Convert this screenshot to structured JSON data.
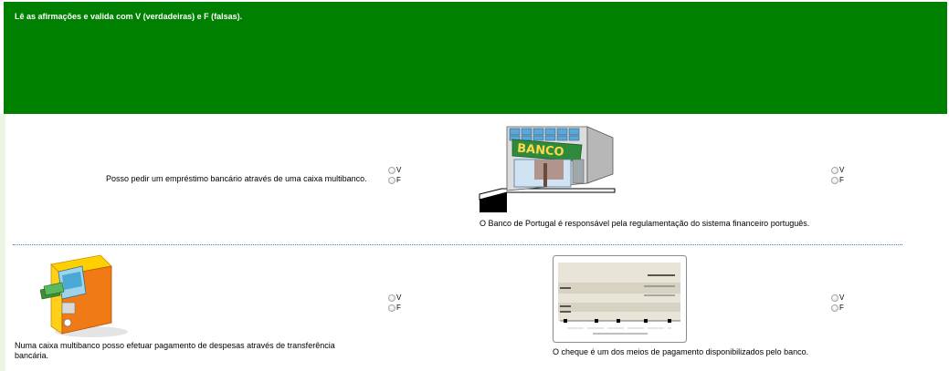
{
  "header": {
    "instruction": "Lê as afirmações e valida com V (verdadeiras) e F (falsas)."
  },
  "colors": {
    "header_bg": "#008000",
    "divider": "#4a74b8"
  },
  "questions": [
    {
      "text": "Posso pedir um empréstimo bancário através de uma caixa multibanco.",
      "options": [
        "V",
        "F"
      ],
      "image": "none"
    },
    {
      "text": "O Banco de Portugal é responsável pela regulamentação do sistema financeiro português.",
      "options": [
        "V",
        "F"
      ],
      "image": "bank-building-illustration",
      "image_sign": "BANCO"
    },
    {
      "text": "Numa caixa multibanco posso efetuar pagamento de despesas através de transferência bancária.",
      "options": [
        "V",
        "F"
      ],
      "image": "atm-machine-illustration"
    },
    {
      "text": "O cheque é um dos meios de pagamento disponibilizados pelo banco.",
      "options": [
        "V",
        "F"
      ],
      "image": "bank-cheque-illustration"
    }
  ]
}
